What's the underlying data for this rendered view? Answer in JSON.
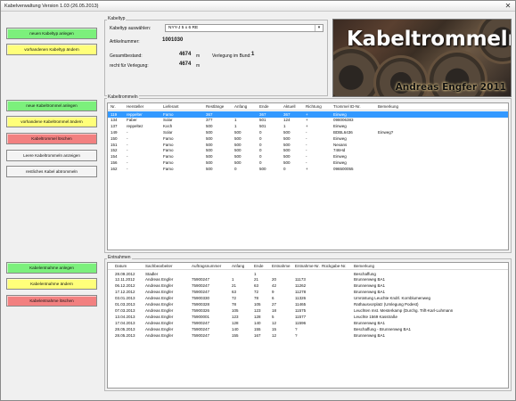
{
  "window": {
    "title": "Kabelverwaltung Version 1.03 (26.05.2013)",
    "close_glyph": "✕"
  },
  "buttons": {
    "new_cable_type": "neuen Kabeltyp anlegen",
    "edit_cable_type": "vorhandenen Kabeltyp ändern",
    "new_drum": "neue Kabeltrommel anlegen",
    "edit_drum": "vorhandene Kabeltrommel ändern",
    "delete_drum": "Kabeltrommel löschen",
    "show_empty_drums": "Leere Kabeltrommeln anzeigen",
    "round_off_rest": "restliches Kabel abtrommeln",
    "new_withdrawal": "Kabelentnahme anlegen",
    "edit_withdrawal": "Kabelentnahme ändern",
    "delete_withdrawal": "Kabelentnahme löschen"
  },
  "colors": {
    "green": "#7cf07c",
    "yellow": "#ffff7a",
    "red": "#f28080",
    "selection": "#3399ff"
  },
  "kabeltyp": {
    "group_label": "Kabeltyp",
    "select_label": "Kabeltyp auswählen:",
    "selected_value": "NYY-J 5 x 6 RE",
    "article_label": "Artikelnummer:",
    "article_value": "1001030",
    "total_label": "Gesamtbestand:",
    "total_value": "4674",
    "total_unit": "m",
    "usable_label": "recht für Verlegung:",
    "usable_value": "4674",
    "usable_unit": "m",
    "bundle_label": "Verlegung im Bund:",
    "bundle_value": "1"
  },
  "banner": {
    "title": "Kabeltrommeln",
    "subtitle": "Andreas Engfer 2011"
  },
  "trommeln": {
    "group_label": "Kabeltrommeln",
    "columns": [
      "Nr.",
      "Hersteller",
      "Lieferant",
      "Restlänge",
      "Anfang",
      "Ende",
      "Aktuell",
      "Richtung",
      "Trommel ID-Nr.",
      "Bemerkung"
    ],
    "rows": [
      [
        "119",
        "reppelter",
        "Famo",
        "367",
        "",
        "367",
        "367",
        "+",
        "Einweg",
        ""
      ],
      [
        "134",
        "Faber",
        "Solar",
        "377",
        "1",
        "501",
        "124",
        "+",
        "098006383",
        ""
      ],
      [
        "137",
        "reppeltez",
        "Koch",
        "500",
        "1",
        "501",
        "1",
        "+",
        "Einweg",
        ""
      ],
      [
        "149",
        "-",
        "Solar",
        "500",
        "500",
        "0",
        "500",
        "-",
        "BDBL6436",
        "Einweg?"
      ],
      [
        "150",
        "-",
        "Famo",
        "500",
        "500",
        "0",
        "500",
        "-",
        "Einweg",
        ""
      ],
      [
        "151",
        "-",
        "Famo",
        "500",
        "500",
        "0",
        "500",
        "-",
        "Nexans",
        ""
      ],
      [
        "152",
        "-",
        "Famo",
        "500",
        "500",
        "0",
        "500",
        "-",
        "746Hd",
        ""
      ],
      [
        "154",
        "-",
        "Famo",
        "500",
        "500",
        "0",
        "500",
        "-",
        "Einweg",
        ""
      ],
      [
        "156",
        "-",
        "Famo",
        "500",
        "500",
        "0",
        "500",
        "-",
        "Einweg",
        ""
      ],
      [
        "162",
        "-",
        "Famo",
        "500",
        "0",
        "500",
        "0",
        "+",
        "096500055",
        ""
      ]
    ]
  },
  "entnahmen": {
    "group_label": "Entnahmen",
    "columns": [
      "Datum",
      "Sachbearbeiter",
      "Auftragsnummer",
      "Anfang",
      "Ende",
      "Entnahme",
      "Entnahme-Nr.",
      "Rückgabe-Nr.",
      "Bemerkung"
    ],
    "rows": [
      [
        "28.09.2012",
        "Stadler",
        "",
        "",
        "1",
        "",
        "",
        "",
        "Beschaffung"
      ],
      [
        "12.11.2012",
        "Andreas Engfer",
        "75900247",
        "1",
        "21",
        "20",
        "11173",
        "",
        "Brunnenweg BA1"
      ],
      [
        "06.12.2012",
        "Andreas Engfer",
        "75900247",
        "21",
        "63",
        "42",
        "11262",
        "",
        "Brunnenweg BA1"
      ],
      [
        "17.12.2012",
        "Andreas Engfer",
        "75900247",
        "63",
        "72",
        "9",
        "11278",
        "",
        "Brunnenweg BA1"
      ],
      [
        "03.01.2013",
        "Andreas Engfer",
        "75900330",
        "72",
        "78",
        "6",
        "11326",
        "",
        "Umrüstung Leuchte Kndrl. Kornblumenweg"
      ],
      [
        "01.03.2013",
        "Andreas Engfer",
        "75900328",
        "78",
        "105",
        "27",
        "11465",
        "",
        "Rathausvorplatz (Umlegung Podest)"
      ],
      [
        "07.03.2013",
        "Andreas Engfer",
        "75900326",
        "105",
        "123",
        "18",
        "11575",
        "",
        "Leuchten mst. Mesterkamp (Durchg. Trift-Karl-Luhmann"
      ],
      [
        "13.04.2013",
        "Andreas Engfer",
        "75900001",
        "123",
        "128",
        "5",
        "11577",
        "",
        "Leuchte 1569 Kasstraße"
      ],
      [
        "17.04.2013",
        "Andreas Engfer",
        "75900247",
        "128",
        "140",
        "12",
        "11596",
        "",
        "Brunnenweg BA1"
      ],
      [
        "28.05.2013",
        "Andreas Engfer",
        "75900247",
        "140",
        "155",
        "15",
        "?",
        "",
        "Beschaffung - Brunnenweg BA1"
      ],
      [
        "28.05.2013",
        "Andreas Engfer",
        "75900247",
        "155",
        "167",
        "12",
        "?",
        "",
        "Brunnenweg BA1"
      ]
    ]
  }
}
